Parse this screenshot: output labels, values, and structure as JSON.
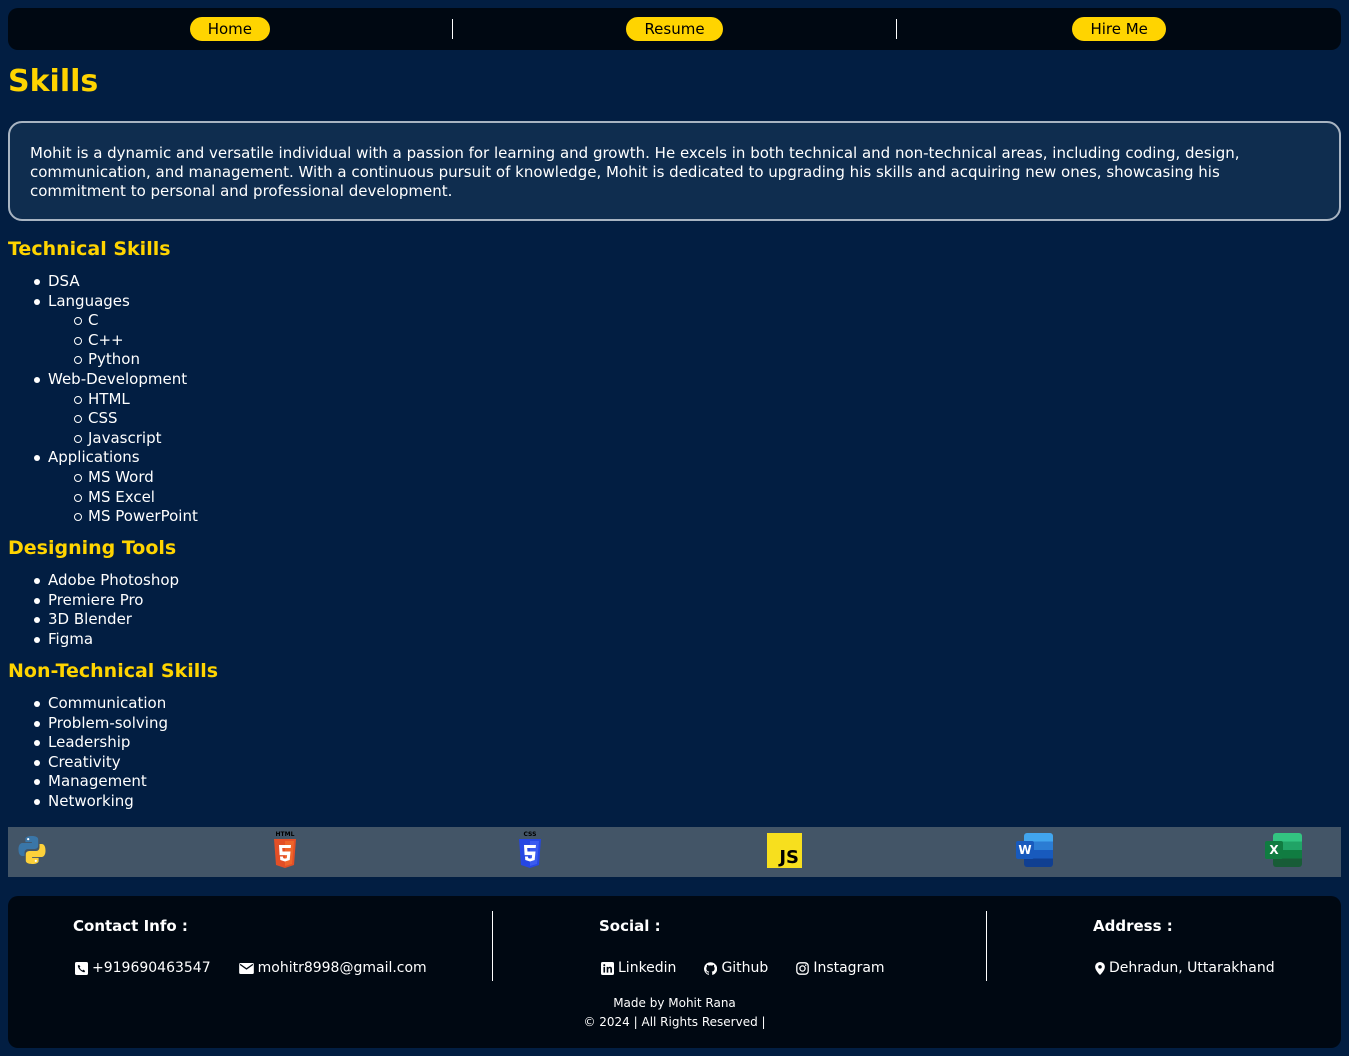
{
  "nav": {
    "items": [
      "Home",
      "Resume",
      "Hire Me"
    ]
  },
  "page_title": "Skills",
  "intro": "Mohit is a dynamic and versatile individual with a passion for learning and growth. He excels in both technical and non-technical areas, including coding, design, communication, and management. With a continuous pursuit of knowledge, Mohit is dedicated to upgrading his skills and acquiring new ones, showcasing his commitment to personal and professional development.",
  "technical": {
    "title": "Technical Skills",
    "items": [
      {
        "label": "DSA",
        "sub": []
      },
      {
        "label": "Languages",
        "sub": [
          "C",
          "C++",
          "Python"
        ]
      },
      {
        "label": "Web-Development",
        "sub": [
          "HTML",
          "CSS",
          "Javascript"
        ]
      },
      {
        "label": "Applications",
        "sub": [
          "MS Word",
          "MS Excel",
          "MS PowerPoint"
        ]
      }
    ]
  },
  "designing": {
    "title": "Designing Tools",
    "items": [
      "Adobe Photoshop",
      "Premiere Pro",
      "3D Blender",
      "Figma"
    ]
  },
  "nontechnical": {
    "title": "Non-Technical Skills",
    "items": [
      "Communication",
      "Problem-solving",
      "Leadership",
      "Creativity",
      "Management",
      "Networking"
    ]
  },
  "icons": [
    "python-icon",
    "html5-icon",
    "css3-icon",
    "javascript-icon",
    "ms-word-icon",
    "ms-excel-icon"
  ],
  "icon_texts": {
    "html": "HTML",
    "css": "CSS",
    "js": "JS",
    "word": "W",
    "excel": "X"
  },
  "footer": {
    "contact": {
      "title": "Contact Info :",
      "phone": "+919690463547",
      "email": "mohitr8998@gmail.com"
    },
    "social": {
      "title": "Social :",
      "linkedin": "Linkedin",
      "github": "Github",
      "instagram": "Instagram"
    },
    "address": {
      "title": "Address :",
      "location": "Dehradun, Uttarakhand"
    },
    "made_by": "Made by Mohit Rana",
    "copyright": "© 2024 | All Rights Reserved |"
  },
  "colors": {
    "accent": "#ffd400",
    "background": "#021e42",
    "panel": "#000812"
  }
}
